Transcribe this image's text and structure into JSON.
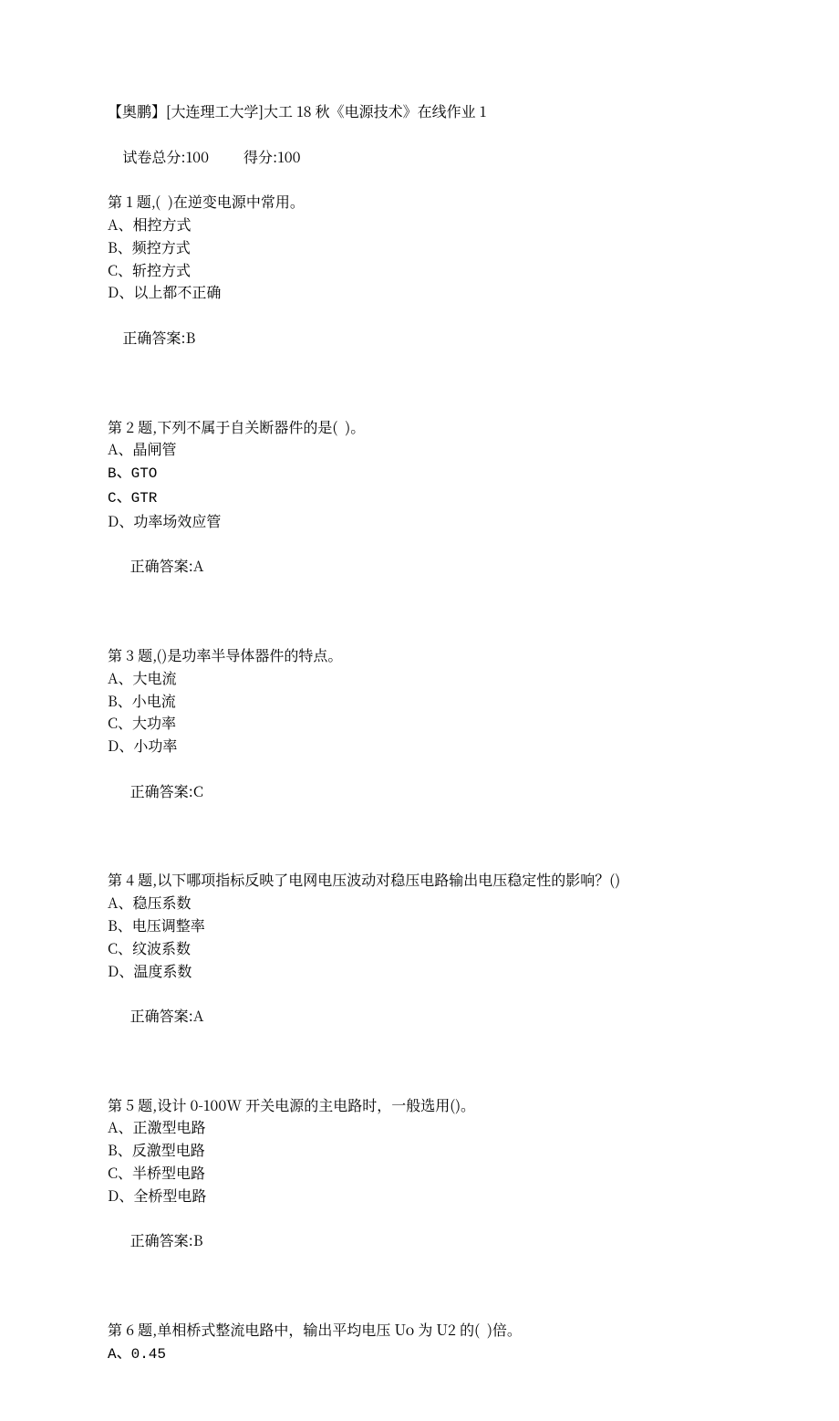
{
  "header": {
    "title": "【奥鹏】[大连理工大学]大工 18 秋《电源技术》在线作业 1",
    "total_label": "试卷总分:",
    "total_value": "100",
    "score_label": "得分:",
    "score_value": "100"
  },
  "questions": [
    {
      "stem": "第 1 题,(  )在逆变电源中常用。",
      "options": [
        "A、相控方式",
        "B、频控方式",
        "C、斩控方式",
        "D、以上都不正确"
      ],
      "answer_label": "正确答案:",
      "answer_value": "B"
    },
    {
      "stem": "第 2 题,下列不属于自关断器件的是(  )。",
      "options": [
        "A、晶闸管",
        "B、GTO",
        "C、GTR",
        "D、功率场效应管"
      ],
      "answer_label": "正确答案:",
      "answer_value": "A"
    },
    {
      "stem": "第 3 题,()是功率半导体器件的特点。",
      "options": [
        "A、大电流",
        "B、小电流",
        "C、大功率",
        "D、小功率"
      ],
      "answer_label": "正确答案:",
      "answer_value": "C"
    },
    {
      "stem": "第 4 题,以下哪项指标反映了电网电压波动对稳压电路输出电压稳定性的影响？()",
      "options": [
        "A、稳压系数",
        "B、电压调整率",
        "C、纹波系数",
        "D、温度系数"
      ],
      "answer_label": "正确答案:",
      "answer_value": "A"
    },
    {
      "stem": "第 5 题,设计 0-100W 开关电源的主电路时，一般选用()。",
      "options": [
        "A、正激型电路",
        "B、反激型电路",
        "C、半桥型电路",
        "D、全桥型电路"
      ],
      "answer_label": "正确答案:",
      "answer_value": "B"
    },
    {
      "stem": "第 6 题,单相桥式整流电路中，输出平均电压 Uo 为 U2 的(  )倍。",
      "options": [
        "A、0.45"
      ],
      "answer_label": "",
      "answer_value": ""
    }
  ]
}
